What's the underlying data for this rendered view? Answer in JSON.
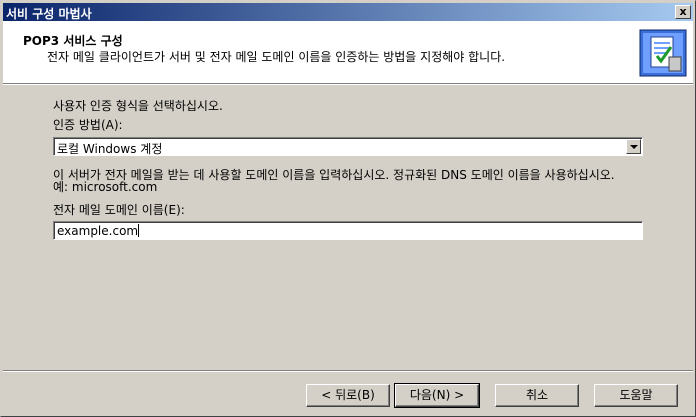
{
  "window": {
    "title": "서비 구성 마법사",
    "close": "x"
  },
  "header": {
    "heading": "POP3 서비스 구성",
    "subheading": "전자 메일 클라이언트가 서버 및 전자 메일 도메인 이름을 인증하는 방법을 지정해야 합니다."
  },
  "body": {
    "instruction": "사용자 인증 형식을 선택하십시오.",
    "auth_label": "인증 방법(A):",
    "auth_value": "로컬 Windows 계정",
    "domain_help_line1": "이 서버가 전자 메일을 받는 데 사용할 도메인 이름을 입력하십시오. 정규화된 DNS 도메인 이름을 사용하십시오.",
    "domain_help_line2": "예: microsoft.com",
    "domain_label": "전자 메일 도메인 이름(E):",
    "domain_value": "example.com"
  },
  "buttons": {
    "back": "< 뒤로(B)",
    "next": "다음(N) >",
    "cancel": "취소",
    "help": "도움말"
  }
}
